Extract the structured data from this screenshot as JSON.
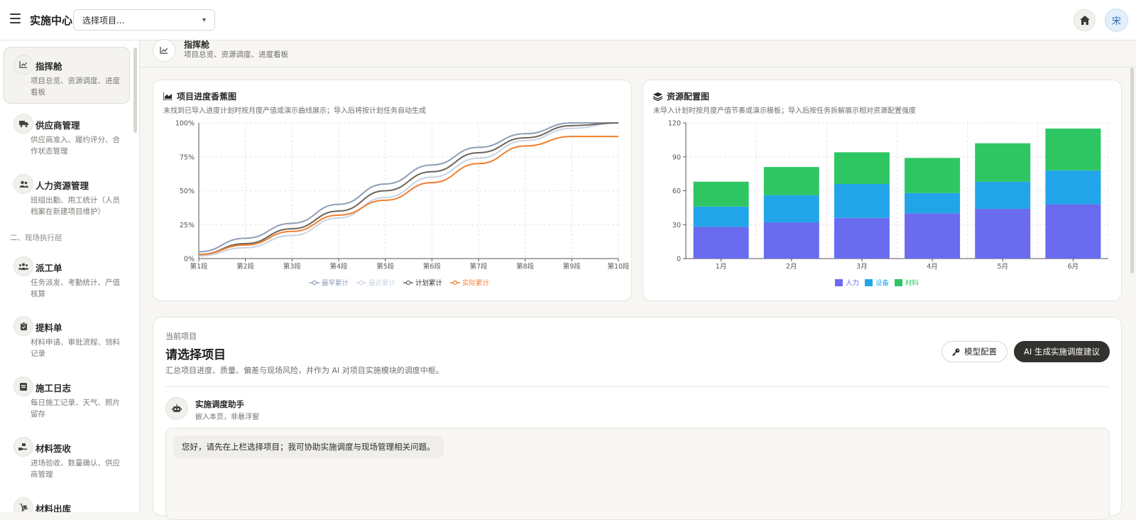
{
  "app_title": "实施中心",
  "project_select": {
    "value": "选择项目..."
  },
  "avatar_text": "宋",
  "sidebar": {
    "items": [
      {
        "title": "指挥舱",
        "desc": "项目总览、资源调度、进度看板",
        "icon": "chart-icon",
        "active": true
      },
      {
        "title": "供应商管理",
        "desc": "供应商准入、履约评分、合作状态管理",
        "icon": "truck-icon"
      },
      {
        "title": "人力资源管理",
        "desc": "班组出勤、用工统计（人员档案在新建项目维护）",
        "icon": "users-icon"
      },
      {
        "title": "派工单",
        "desc": "任务派发、考勤统计、产值核算",
        "icon": "team-icon"
      },
      {
        "title": "提料单",
        "desc": "材料申请、审批流程、领料记录",
        "icon": "clipboard-icon"
      },
      {
        "title": "施工日志",
        "desc": "每日施工记录、天气、照片留存",
        "icon": "journal-icon"
      },
      {
        "title": "材料签收",
        "desc": "进场验收、数量确认、供应商管理",
        "icon": "receive-icon"
      },
      {
        "title": "材料出库",
        "desc": "",
        "icon": "dolly-icon"
      }
    ],
    "section_label": "二、现场执行层"
  },
  "page_header": {
    "title": "指挥舱",
    "desc": "项目总览、资源调度、进度看板"
  },
  "progress_card": {
    "title": "项目进度香蕉图",
    "subtitle": "未找到已导入进度计划时按月度产值或演示曲线展示；导入后将按计划任务自动生成"
  },
  "resource_card": {
    "title": "资源配置图",
    "subtitle": "未导入计划时按月度产值节奏或演示模板；导入后按任务拆解展示相对资源配置强度"
  },
  "chart_data": [
    {
      "type": "line",
      "title": "项目进度香蕉图",
      "x": [
        "第1段",
        "第2段",
        "第3段",
        "第4段",
        "第5段",
        "第6段",
        "第7段",
        "第8段",
        "第9段",
        "第10段"
      ],
      "ylim": [
        0,
        100
      ],
      "yticks": [
        "0%",
        "25%",
        "50%",
        "75%",
        "100%"
      ],
      "grid": true,
      "legend": "bottom",
      "series": [
        {
          "name": "最早累计",
          "color": "#8e9db5",
          "values": [
            5,
            15,
            26,
            40,
            55,
            69,
            82,
            92,
            100,
            100
          ]
        },
        {
          "name": "最迟累计",
          "color": "#c8d3e2",
          "values": [
            2,
            8,
            17,
            30,
            45,
            60,
            74,
            87,
            96,
            100
          ]
        },
        {
          "name": "计划累计",
          "color": "#6e655c",
          "values": [
            3,
            11,
            22,
            35,
            50,
            64,
            78,
            89,
            98,
            100
          ]
        },
        {
          "name": "实际累计",
          "color": "#f07f2e",
          "values": [
            3,
            10,
            20,
            32,
            43,
            56,
            70,
            83,
            90,
            90
          ]
        }
      ]
    },
    {
      "type": "bar",
      "title": "资源配置图",
      "stacked": true,
      "categories": [
        "1月",
        "2月",
        "3月",
        "4月",
        "5月",
        "6月"
      ],
      "ylim": [
        0,
        120
      ],
      "yticks": [
        "0",
        "30",
        "60",
        "90",
        "120"
      ],
      "grid": true,
      "legend": "bottom",
      "series": [
        {
          "name": "人力",
          "color": "#6a6bef",
          "values": [
            28,
            32,
            36,
            40,
            44,
            48
          ]
        },
        {
          "name": "设备",
          "color": "#22a5e8",
          "values": [
            18,
            24,
            30,
            18,
            24,
            30
          ]
        },
        {
          "name": "材料",
          "color": "#2ec663",
          "values": [
            22,
            25,
            28,
            31,
            34,
            37
          ]
        }
      ]
    }
  ],
  "project_card": {
    "label": "当前项目",
    "title": "请选择项目",
    "desc": "汇总项目进度、质量、偏差与现场风险，并作为 AI 对项目实施模块的调度中枢。",
    "model_button": "模型配置",
    "ai_button": "AI 生成实施调度建议"
  },
  "assistant": {
    "title": "实施调度助手",
    "subtitle": "嵌入本页，非悬浮窗",
    "message": "您好，请先在上栏选择项目；我可协助实施调度与现场管理相关问题。"
  }
}
